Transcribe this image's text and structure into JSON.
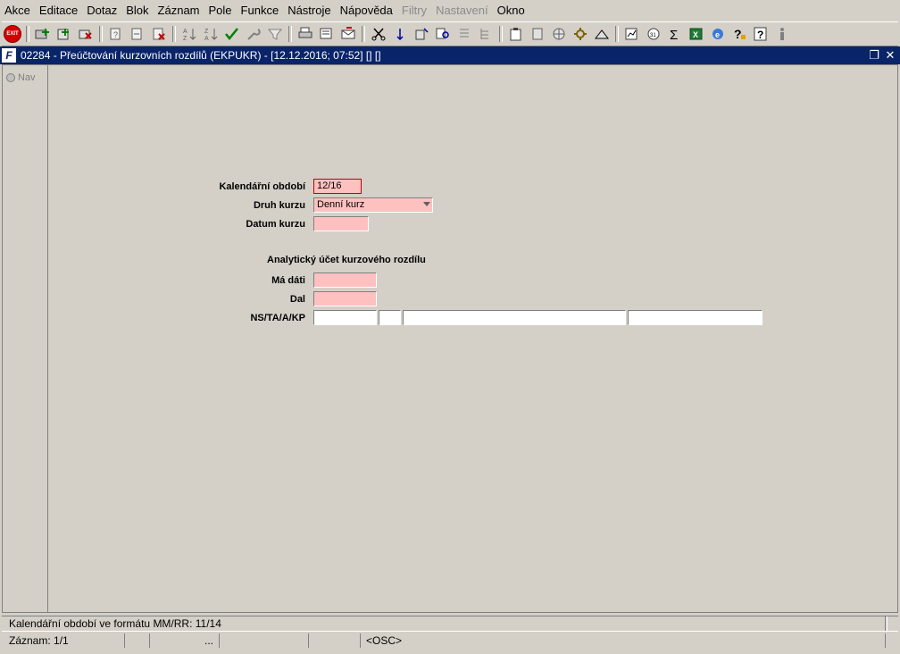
{
  "menu": [
    {
      "key": "akce",
      "label": "Akce",
      "disabled": false
    },
    {
      "key": "editace",
      "label": "Editace",
      "disabled": false
    },
    {
      "key": "dotaz",
      "label": "Dotaz",
      "disabled": false
    },
    {
      "key": "blok",
      "label": "Blok",
      "disabled": false
    },
    {
      "key": "zaznam",
      "label": "Záznam",
      "disabled": false
    },
    {
      "key": "pole",
      "label": "Pole",
      "disabled": false
    },
    {
      "key": "funkce",
      "label": "Funkce",
      "disabled": false
    },
    {
      "key": "nastroje",
      "label": "Nástroje",
      "disabled": false
    },
    {
      "key": "napoveda",
      "label": "Nápověda",
      "disabled": false
    },
    {
      "key": "filtry",
      "label": "Filtry",
      "disabled": true
    },
    {
      "key": "nastaveni",
      "label": "Nastavení",
      "disabled": true
    },
    {
      "key": "okno",
      "label": "Okno",
      "disabled": false
    }
  ],
  "toolbar": {
    "exit_label": "EXIT",
    "icons": [
      "save-icon",
      "insert-record-icon",
      "delete-record-icon",
      "enter-query-icon",
      "execute-query-icon",
      "cancel-query-icon",
      "sort-asc-icon",
      "sort-desc-icon",
      "commit-check-icon",
      "tools-icon",
      "filter-icon",
      "print-icon",
      "print-preview-icon",
      "mail-icon",
      "cut-icon",
      "copy-icon",
      "paste-icon",
      "search-icon",
      "list-icon",
      "tree-icon",
      "clipboard-icon",
      "document-icon",
      "globe-icon",
      "settings-icon",
      "triangle-icon",
      "chart-icon",
      "calendar-icon",
      "sum-icon",
      "excel-icon",
      "ie-icon",
      "help-icon",
      "context-help-icon",
      "info-icon"
    ]
  },
  "window": {
    "title": "02284 - Přeúčtování kurzovních rozdílů (EKPUKR) - [12.12.2016; 07:52] [] []",
    "app_icon": "F"
  },
  "nav": {
    "label": "Nav"
  },
  "form": {
    "kalendarni_obdobi_label": "Kalendářní období",
    "kalendarni_obdobi_value": "12/16",
    "druh_kurzu_label": "Druh kurzu",
    "druh_kurzu_value": "Denní kurz",
    "datum_kurzu_label": "Datum kurzu",
    "datum_kurzu_value": "",
    "section_title": "Analytický účet kurzového rozdílu",
    "ma_dati_label": "Má dáti",
    "ma_dati_value": "",
    "dal_label": "Dal",
    "dal_value": "",
    "ns_label": "NS/TA/A/KP",
    "ns_values": [
      "",
      "",
      "",
      ""
    ]
  },
  "status": {
    "hint": "Kalendářní období ve formátu MM/RR: 11/14",
    "record": "Záznam: 1/1",
    "dots": "...",
    "mode": "<OSC>"
  }
}
